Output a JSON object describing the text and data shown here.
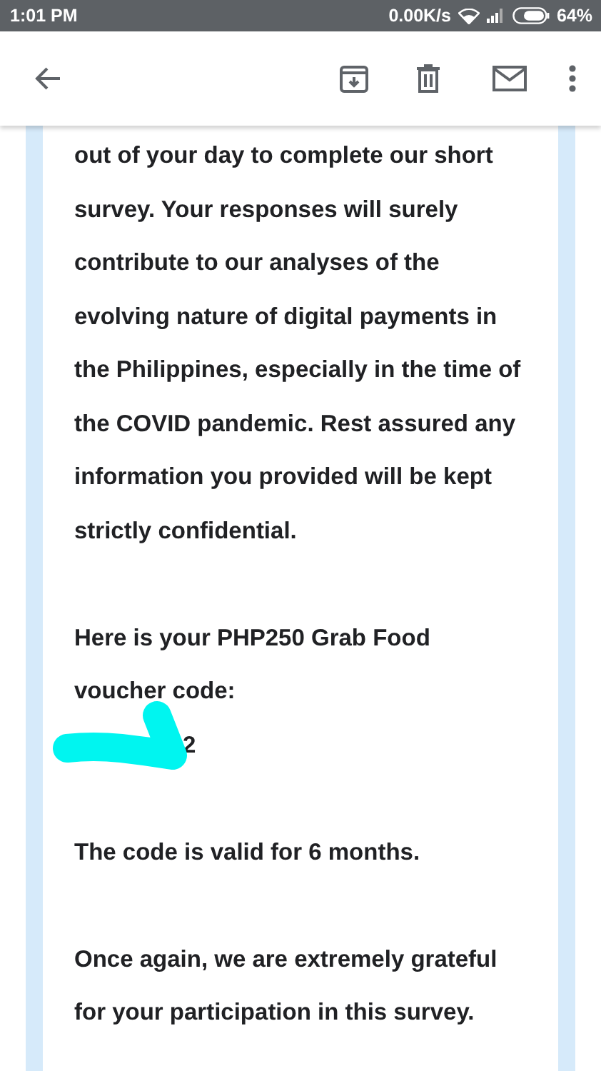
{
  "status_bar": {
    "time": "1:01 PM",
    "network_speed": "0.00K/s",
    "battery_percent": "64%"
  },
  "message": {
    "blocks": [
      {
        "kind": "text",
        "lines": [
          "out of your day to complete our short",
          "survey. Your responses will surely",
          "contribute to our analyses of the",
          "evolving nature of digital payments in",
          "the Philippines, especially in the time of",
          "the COVID pandemic. Rest assured any",
          "information you provided will be kept",
          "strictly confidential."
        ]
      },
      {
        "kind": "text",
        "lines": [
          "Here is your PHP250 Grab Food",
          "voucher code:"
        ]
      },
      {
        "kind": "redacted",
        "text": "2"
      },
      {
        "kind": "text",
        "lines": [
          "The code is valid for 6 months."
        ]
      },
      {
        "kind": "text",
        "lines": [
          "Once again, we are extremely grateful",
          "for your participation in this survey."
        ]
      }
    ]
  }
}
